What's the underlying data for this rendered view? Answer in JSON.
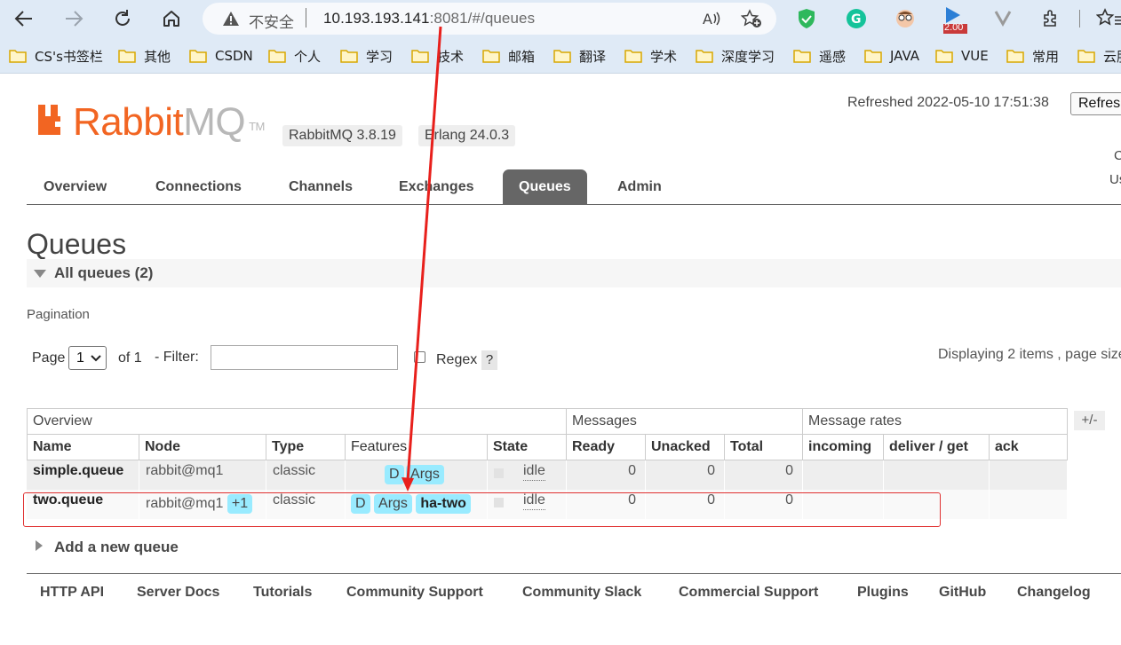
{
  "browser": {
    "insecure_label": "不安全",
    "url_host": "10.193.193.141",
    "url_rest": ":8081/#/queues",
    "ext_badge": "2.00",
    "bookmarks": [
      "CS's书签栏",
      "其他",
      "CSDN",
      "个人",
      "学习",
      "技术",
      "邮箱",
      "翻译",
      "学术",
      "深度学习",
      "遥感",
      "JAVA",
      "VUE",
      "常用",
      "云服"
    ]
  },
  "header": {
    "logo_main": "Rabbit",
    "logo_mq": "MQ",
    "logo_tm": "TM",
    "version": "RabbitMQ 3.8.19",
    "erlang": "Erlang 24.0.3",
    "refreshed": "Refreshed 2022-05-10 17:51:38",
    "refresh_btn": "Refresh",
    "cut_1": "C",
    "cut_2": "Us"
  },
  "tabs": [
    "Overview",
    "Connections",
    "Channels",
    "Exchanges",
    "Queues",
    "Admin"
  ],
  "page": {
    "title": "Queues",
    "section": "All queues (2)",
    "pagination_label": "Pagination",
    "page_label": "Page",
    "page_value": "1",
    "of_label": "of 1",
    "filter_label": "- Filter:",
    "regex_label": "Regex",
    "help": "?",
    "displaying": "Displaying 2 items , page size",
    "plus_minus": "+/-",
    "add_queue": "Add a new queue"
  },
  "table": {
    "groups": [
      "Overview",
      "Messages",
      "Message rates"
    ],
    "headers": [
      "Name",
      "Node",
      "Type",
      "Features",
      "State",
      "Ready",
      "Unacked",
      "Total",
      "incoming",
      "deliver / get",
      "ack"
    ],
    "rows": [
      {
        "name": "simple.queue",
        "node": "rabbit@mq1",
        "node_extra": "",
        "type": "classic",
        "f1": "D",
        "f2": "Args",
        "f3": "",
        "state": "idle",
        "ready": "0",
        "unacked": "0",
        "total": "0"
      },
      {
        "name": "two.queue",
        "node": "rabbit@mq1",
        "node_extra": "+1",
        "type": "classic",
        "f1": "D",
        "f2": "Args",
        "f3": "ha-two",
        "state": "idle",
        "ready": "0",
        "unacked": "0",
        "total": "0"
      }
    ]
  },
  "footer": [
    "HTTP API",
    "Server Docs",
    "Tutorials",
    "Community Support",
    "Community Slack",
    "Commercial Support",
    "Plugins",
    "GitHub",
    "Changelog"
  ]
}
